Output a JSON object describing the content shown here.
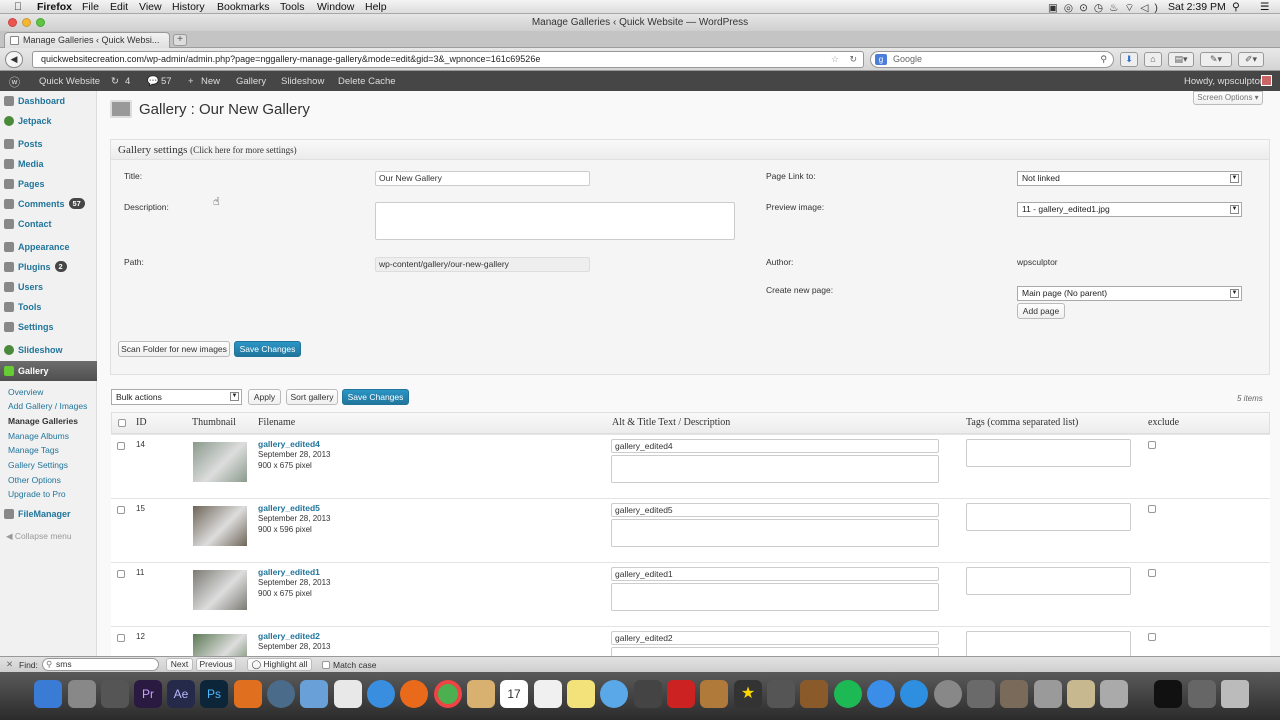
{
  "os_menubar": {
    "app": "Firefox",
    "menus": [
      "File",
      "Edit",
      "View",
      "History",
      "Bookmarks",
      "Tools",
      "Window",
      "Help"
    ],
    "clock": "Sat 2:39 PM"
  },
  "window": {
    "title": "Manage Galleries ‹ Quick Website — WordPress"
  },
  "tab": {
    "title": "Manage Galleries ‹ Quick Websi..."
  },
  "url": "quickwebsitecreation.com/wp-admin/admin.php?page=nggallery-manage-gallery&mode=edit&gid=3&_wpnonce=161c69526e",
  "search_engine": "Google",
  "wp_adminbar": {
    "site": "Quick Website",
    "updates": "4",
    "comments": "57",
    "new": "New",
    "items": [
      "Gallery",
      "Slideshow",
      "Delete Cache"
    ],
    "howdy": "Howdy, wpsculptor"
  },
  "sidebar": {
    "items": [
      {
        "label": "Dashboard"
      },
      {
        "label": "Jetpack"
      },
      {
        "label": "Posts"
      },
      {
        "label": "Media"
      },
      {
        "label": "Pages"
      },
      {
        "label": "Comments",
        "badge": "57"
      },
      {
        "label": "Contact"
      },
      {
        "label": "Appearance"
      },
      {
        "label": "Plugins",
        "badge": "2"
      },
      {
        "label": "Users"
      },
      {
        "label": "Tools"
      },
      {
        "label": "Settings"
      },
      {
        "label": "Slideshow"
      },
      {
        "label": "Gallery"
      }
    ],
    "submenu": [
      "Overview",
      "Add Gallery / Images",
      "Manage Galleries",
      "Manage Albums",
      "Manage Tags",
      "Gallery Settings",
      "Other Options",
      "Upgrade to Pro"
    ],
    "after": [
      {
        "label": "FileManager"
      }
    ],
    "collapse": "Collapse menu"
  },
  "page": {
    "title": "Gallery : Our New Gallery",
    "screen_options": "Screen Options",
    "settings_heading": "Gallery settings",
    "settings_hint": "(Click here for more settings)",
    "title_label": "Title:",
    "title_value": "Our New Gallery",
    "description_label": "Description:",
    "path_label": "Path:",
    "path_value": "wp-content/gallery/our-new-gallery",
    "page_link_label": "Page Link to:",
    "page_link_value": "Not linked",
    "preview_label": "Preview image:",
    "preview_value": "11 - gallery_edited1.jpg",
    "author_label": "Author:",
    "author_value": "wpsculptor",
    "create_page_label": "Create new page:",
    "create_page_value": "Main page (No parent)",
    "add_page_btn": "Add page",
    "scan_btn": "Scan Folder for new images",
    "save_btn": "Save Changes",
    "bulk_actions": "Bulk actions",
    "apply_btn": "Apply",
    "sort_btn": "Sort gallery",
    "save_btn2": "Save Changes",
    "item_count": "5 items"
  },
  "table": {
    "columns": [
      "ID",
      "Thumbnail",
      "Filename",
      "Alt & Title Text / Description",
      "Tags (comma separated list)",
      "exclude"
    ],
    "rows": [
      {
        "id": "14",
        "filename": "gallery_edited4",
        "date": "September 28, 2013",
        "size": "900 x 675 pixel",
        "alt": "gallery_edited4",
        "thumb_color": "#8a9a8c"
      },
      {
        "id": "15",
        "filename": "gallery_edited5",
        "date": "September 28, 2013",
        "size": "900 x 596 pixel",
        "alt": "gallery_edited5",
        "thumb_color": "#6e6558"
      },
      {
        "id": "11",
        "filename": "gallery_edited1",
        "date": "September 28, 2013",
        "size": "900 x 675 pixel",
        "alt": "gallery_edited1",
        "thumb_color": "#7b7a74"
      },
      {
        "id": "12",
        "filename": "gallery_edited2",
        "date": "September 28, 2013",
        "size": "",
        "alt": "gallery_edited2",
        "thumb_color": "#5d7a55"
      }
    ]
  },
  "findbar": {
    "label": "Find:",
    "value": "sms",
    "next": "Next",
    "previous": "Previous",
    "highlight": "Highlight all",
    "match_case": "Match case"
  },
  "colors": {
    "wp_link": "#21759b",
    "adminbar": "#464646",
    "primary_button": "#21759b"
  }
}
